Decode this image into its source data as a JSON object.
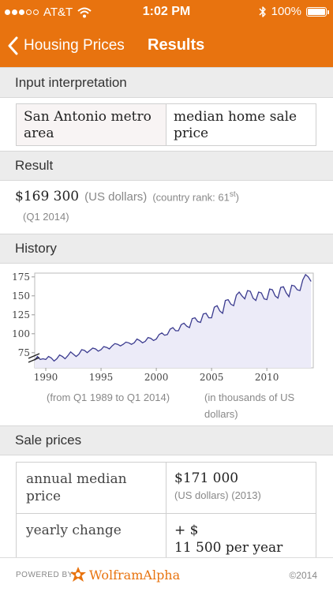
{
  "status_bar": {
    "carrier": "AT&T",
    "time": "1:02 PM",
    "battery": "100%"
  },
  "nav": {
    "back_label": "Housing Prices",
    "title": "Results"
  },
  "input_interpretation": {
    "header": "Input interpretation",
    "left": "San Antonio metro area",
    "right": "median home sale price"
  },
  "result": {
    "header": "Result",
    "value": "$169 300",
    "unit": "(US dollars)",
    "rank_prefix": "(country rank: 61",
    "rank_sup": "st",
    "rank_suffix": ")",
    "period": "(Q1 2014)"
  },
  "history": {
    "header": "History",
    "note_left": "(from Q1 1989 to Q1 2014)",
    "note_right": "(in thousands of US dollars)"
  },
  "chart_data": {
    "type": "line",
    "title": "",
    "xlabel": "",
    "ylabel": "",
    "xlim": [
      1989,
      2014.2
    ],
    "ylim": [
      55,
      180
    ],
    "x_ticks": [
      1990,
      1995,
      2000,
      2005,
      2010
    ],
    "y_ticks": [
      75,
      100,
      125,
      150,
      175
    ],
    "y_axis_break": true,
    "series": [
      {
        "x": [
          1989.0,
          1989.25,
          1989.5,
          1989.75,
          1990.0,
          1990.25,
          1990.5,
          1990.75,
          1991.0,
          1991.25,
          1991.5,
          1991.75,
          1992.0,
          1992.25,
          1992.5,
          1992.75,
          1993.0,
          1993.25,
          1993.5,
          1993.75,
          1994.0,
          1994.25,
          1994.5,
          1994.75,
          1995.0,
          1995.25,
          1995.5,
          1995.75,
          1996.0,
          1996.25,
          1996.5,
          1996.75,
          1997.0,
          1997.25,
          1997.5,
          1997.75,
          1998.0,
          1998.25,
          1998.5,
          1998.75,
          1999.0,
          1999.25,
          1999.5,
          1999.75,
          2000.0,
          2000.25,
          2000.5,
          2000.75,
          2001.0,
          2001.25,
          2001.5,
          2001.75,
          2002.0,
          2002.25,
          2002.5,
          2002.75,
          2003.0,
          2003.25,
          2003.5,
          2003.75,
          2004.0,
          2004.25,
          2004.5,
          2004.75,
          2005.0,
          2005.25,
          2005.5,
          2005.75,
          2006.0,
          2006.25,
          2006.5,
          2006.75,
          2007.0,
          2007.25,
          2007.5,
          2007.75,
          2008.0,
          2008.25,
          2008.5,
          2008.75,
          2009.0,
          2009.25,
          2009.5,
          2009.75,
          2010.0,
          2010.25,
          2010.5,
          2010.75,
          2011.0,
          2011.25,
          2011.5,
          2011.75,
          2012.0,
          2012.25,
          2012.5,
          2012.75,
          2013.0,
          2013.25,
          2013.5,
          2013.75,
          2014.0
        ],
        "values": [
          65,
          70,
          66,
          67,
          66,
          70,
          68,
          64,
          67,
          72,
          70,
          67,
          71,
          76,
          73,
          70,
          73,
          79,
          78,
          75,
          78,
          81,
          80,
          77,
          79,
          83,
          82,
          80,
          84,
          87,
          86,
          84,
          86,
          89,
          88,
          86,
          88,
          93,
          91,
          88,
          90,
          95,
          94,
          91,
          93,
          99,
          101,
          98,
          99,
          106,
          108,
          104,
          104,
          112,
          114,
          110,
          108,
          120,
          121,
          116,
          115,
          126,
          127,
          121,
          121,
          135,
          137,
          130,
          127,
          144,
          145,
          139,
          137,
          151,
          155,
          150,
          146,
          157,
          156,
          147,
          144,
          155,
          154,
          146,
          145,
          159,
          158,
          150,
          147,
          161,
          162,
          154,
          149,
          164,
          163,
          158,
          157,
          171,
          178,
          175,
          169
        ]
      }
    ]
  }
}
